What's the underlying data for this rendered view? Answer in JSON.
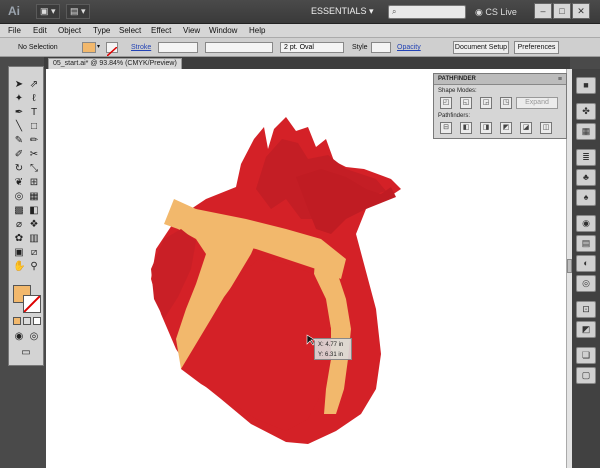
{
  "app": {
    "logo": "Ai",
    "workspace": "ESSENTIALS",
    "cslive": "CS Live",
    "win_min": "–",
    "win_max": "□",
    "win_close": "✕"
  },
  "menu": [
    "File",
    "Edit",
    "Object",
    "Type",
    "Select",
    "Effect",
    "View",
    "Window",
    "Help"
  ],
  "control": {
    "selection": "No Selection",
    "stroke_label": "Stroke",
    "brush": "2 pt. Oval",
    "style_label": "Style",
    "opacity_label": "Opacity",
    "doc_setup": "Document Setup",
    "preferences": "Preferences"
  },
  "document": {
    "tab": "05_start.ai* @ 93.84% (CMYK/Preview)"
  },
  "pathfinder": {
    "title": "PATHFINDER",
    "shape_modes": "Shape Modes:",
    "pathfinders": "Pathfinders:",
    "expand": "Expand"
  },
  "cursor": {
    "x": "X: 4.77 in",
    "y": "Y: 6.31 in"
  },
  "colors": {
    "heart_red": "#d42127",
    "heart_dark": "#b51b22",
    "fill_swatch": "#f2b86c",
    "accent": "#e9b874"
  }
}
